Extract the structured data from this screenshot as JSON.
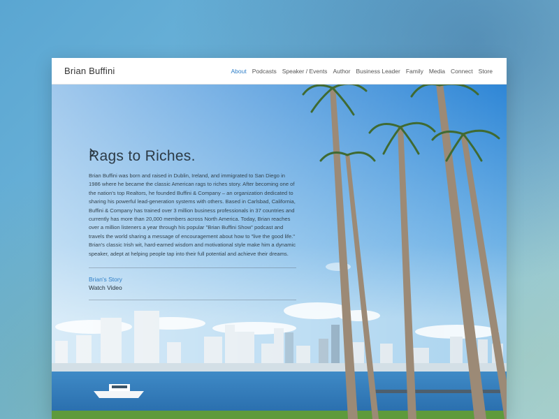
{
  "header": {
    "brand": "Brian Buffini",
    "nav": [
      {
        "label": "About",
        "active": true
      },
      {
        "label": "Podcasts",
        "active": false
      },
      {
        "label": "Speaker / Events",
        "active": false
      },
      {
        "label": "Author",
        "active": false
      },
      {
        "label": "Business Leader",
        "active": false
      },
      {
        "label": "Family",
        "active": false
      },
      {
        "label": "Media",
        "active": false
      },
      {
        "label": "Connect",
        "active": false
      },
      {
        "label": "Store",
        "active": false
      }
    ]
  },
  "hero": {
    "headline": "Rags to Riches.",
    "body": "Brian Buffini was born and raised in Dublin, Ireland, and immigrated to San Diego in 1986 where he became the classic American rags to riches story. After becoming one of the nation's top Realtors, he founded Buffini & Company – an organization dedicated to sharing his powerful lead-generation systems with others. Based in Carlsbad, California, Buffini & Company has trained over 3 million business professionals in 37 countries and currently has more than 20,000 members across North America. Today, Brian reaches over a million listeners a year through his popular \"Brian Buffini Show\" podcast and travels the world sharing a message of encouragement about how to \"live the good life.\" Brian's classic Irish wit, hard-earned wisdom and motivational style make him a dynamic speaker, adept at helping people tap into their full potential and achieve their dreams.",
    "story_link": "Brian's Story",
    "watch_label": "Watch Video"
  },
  "colors": {
    "accent": "#2f7fc8",
    "sky_top": "#2e86d6",
    "sky_bottom": "#a9d3ef",
    "water": "#2f78b8",
    "grass": "#5e9a3c"
  },
  "icons": {
    "story_arrow": "chevron-right-icon"
  }
}
